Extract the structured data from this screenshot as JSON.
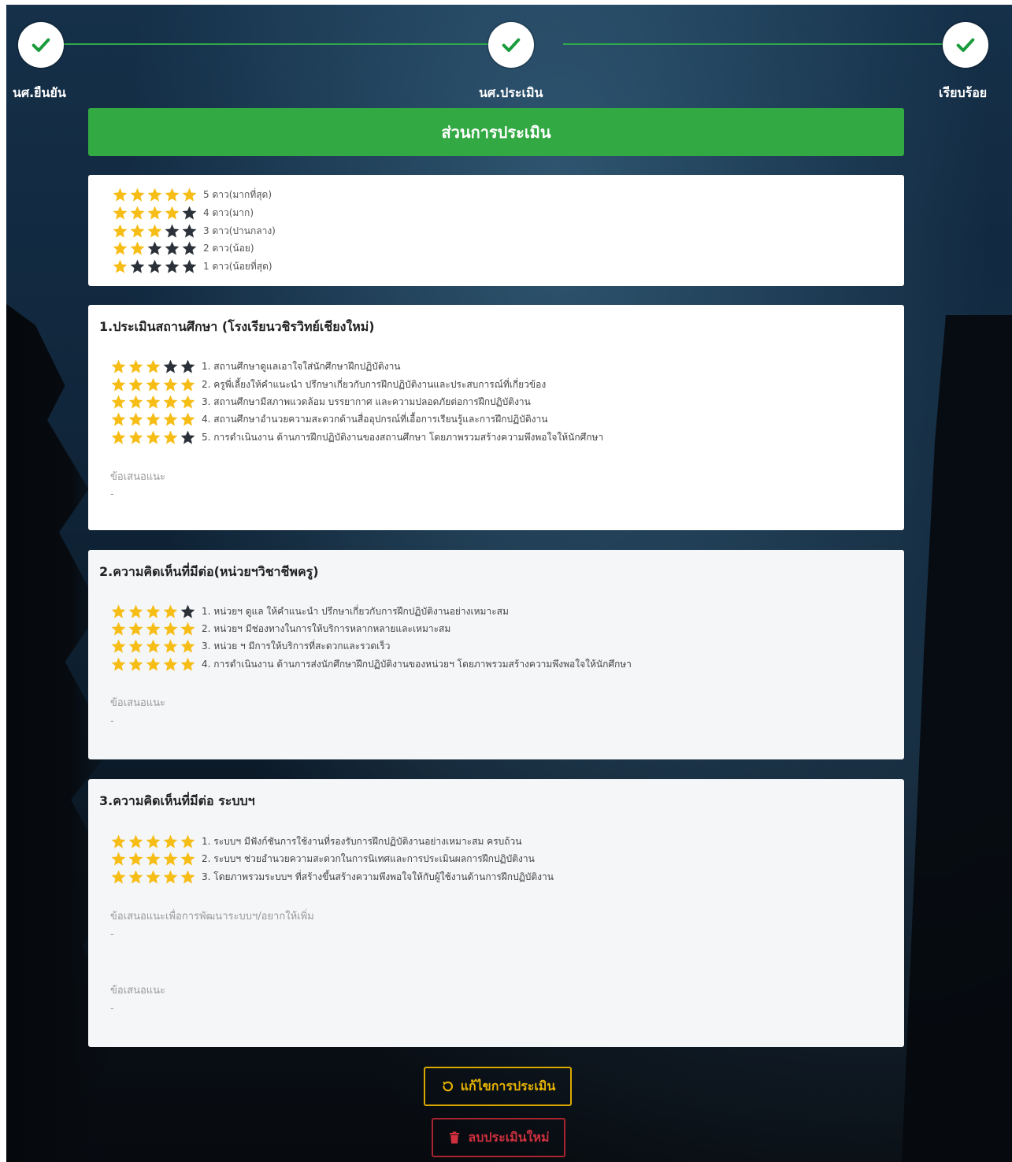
{
  "steps": [
    {
      "label": "นศ.ยืนยัน",
      "done": true
    },
    {
      "label": "นศ.ประเมิน",
      "done": true
    },
    {
      "label": "เรียบร้อย",
      "done": true
    }
  ],
  "header": {
    "title": "ส่วนการประเมิน"
  },
  "legend": [
    {
      "stars": 5,
      "label": "5 ดาว(มากที่สุด)"
    },
    {
      "stars": 4,
      "label": "4 ดาว(มาก)"
    },
    {
      "stars": 3,
      "label": "3 ดาว(ปานกลาง)"
    },
    {
      "stars": 2,
      "label": "2 ดาว(น้อย)"
    },
    {
      "stars": 1,
      "label": "1 ดาว(น้อยที่สุด)"
    }
  ],
  "sections": [
    {
      "title": "1.ประเมินสถานศึกษา (โรงเรียนวชิรวิทย์เชียงใหม่)",
      "questions": [
        {
          "rating": 3,
          "text": "1. สถานศึกษาดูแลเอาใจใส่นักศึกษาฝึกปฏิบัติงาน"
        },
        {
          "rating": 5,
          "text": "2. ครูพี่เลี้ยงให้คำแนะนำ ปรึกษาเกี่ยวกับการฝึกปฏิบัติงานและประสบการณ์ที่เกี่ยวข้อง"
        },
        {
          "rating": 5,
          "text": "3. สถานศึกษามีสภาพแวดล้อม บรรยากาศ และความปลอดภัยต่อการฝึกปฏิบัติงาน"
        },
        {
          "rating": 5,
          "text": "4. สถานศึกษาอำนวยความสะดวกด้านสื่ออุปกรณ์ที่เอื้อการเรียนรู้และการฝึกปฏิบัติงาน"
        },
        {
          "rating": 4,
          "text": "5. การดำเนินงาน ด้านการฝึกปฏิบัติงานของสถานศึกษา โดยภาพรวมสร้างความพึงพอใจให้นักศึกษา"
        }
      ],
      "suggestions": [
        {
          "label": "ข้อเสนอแนะ",
          "value": "-"
        }
      ]
    },
    {
      "title": "2.ความคิดเห็นที่มีต่อ(หน่วยฯวิชาชีพครู)",
      "questions": [
        {
          "rating": 4,
          "text": "1. หน่วยฯ ดูแล ให้คำแนะนำ ปรึกษาเกี่ยวกับการฝึกปฏิบัติงานอย่างเหมาะสม"
        },
        {
          "rating": 5,
          "text": "2. หน่วยฯ มีช่องทางในการให้บริการหลากหลายและเหมาะสม"
        },
        {
          "rating": 5,
          "text": "3. หน่วย ฯ มีการให้บริการที่สะดวกและรวดเร็ว"
        },
        {
          "rating": 5,
          "text": "4. การดำเนินงาน ด้านการส่งนักศึกษาฝึกปฏิบัติงานของหน่วยฯ โดยภาพรวมสร้างความพึงพอใจให้นักศึกษา"
        }
      ],
      "suggestions": [
        {
          "label": "ข้อเสนอแนะ",
          "value": "-"
        }
      ]
    },
    {
      "title": "3.ความคิดเห็นที่มีต่อ ระบบฯ",
      "questions": [
        {
          "rating": 5,
          "text": "1. ระบบฯ มีฟังก์ชันการใช้งานที่รองรับการฝึกปฏิบัติงานอย่างเหมาะสม ครบถ้วน"
        },
        {
          "rating": 5,
          "text": "2. ระบบฯ ช่วยอำนวยความสะดวกในการนิเทศและการประเมินผลการฝึกปฏิบัติงาน"
        },
        {
          "rating": 5,
          "text": "3. โดยภาพรวมระบบฯ ที่สร้างขึ้นสร้างความพึงพอใจให้กับผู้ใช้งานด้านการฝึกปฏิบัติงาน"
        }
      ],
      "suggestions": [
        {
          "label": "ข้อเสนอแนะเพื่อการพัฒนาระบบฯ/อยากให้เพิ่ม",
          "value": "-"
        },
        {
          "label": "ข้อเสนอแนะ",
          "value": "-"
        }
      ]
    }
  ],
  "buttons": {
    "edit_label": "แก้ไขการประเมิน",
    "delete_label": "ลบประเมินใหม่"
  },
  "colors": {
    "star_on": "#f7bd17",
    "star_off": "#2b3138",
    "success": "#33a944",
    "edit": "#e8b400",
    "delete": "#d0303e"
  },
  "icons": {
    "step": "check-icon",
    "edit": "undo-icon",
    "delete": "trash-icon",
    "rating": "star-icon"
  }
}
